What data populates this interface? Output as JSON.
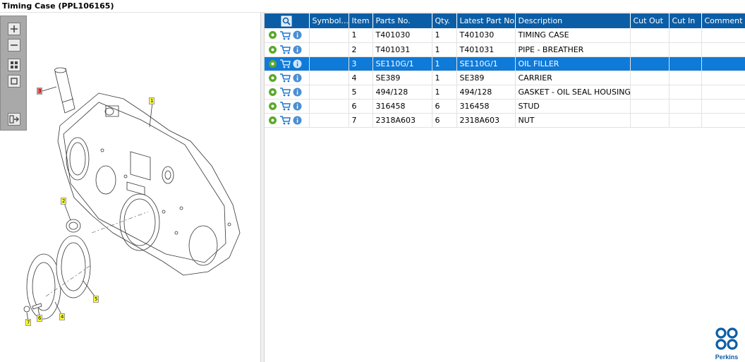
{
  "window": {
    "title": "Timing Case (PPL106165)"
  },
  "table": {
    "headers": [
      "",
      "Symbol...",
      "Item",
      "Parts No.",
      "Qty.",
      "Latest Part No.",
      "Description",
      "Cut Out",
      "Cut In",
      "Comment"
    ],
    "rows": [
      {
        "symbol": "",
        "item": "1",
        "part_no": "T401030",
        "qty": "1",
        "latest_part_no": "T401030",
        "description": "TIMING CASE",
        "cut_out": "",
        "cut_in": "",
        "comment": ""
      },
      {
        "symbol": "",
        "item": "2",
        "part_no": "T401031",
        "qty": "1",
        "latest_part_no": "T401031",
        "description": "PIPE - BREATHER",
        "cut_out": "",
        "cut_in": "",
        "comment": ""
      },
      {
        "symbol": "",
        "item": "3",
        "part_no": "SE110G/1",
        "qty": "1",
        "latest_part_no": "SE110G/1",
        "description": "OIL FILLER",
        "cut_out": "",
        "cut_in": "",
        "comment": ""
      },
      {
        "symbol": "",
        "item": "4",
        "part_no": "SE389",
        "qty": "1",
        "latest_part_no": "SE389",
        "description": "CARRIER",
        "cut_out": "",
        "cut_in": "",
        "comment": ""
      },
      {
        "symbol": "",
        "item": "5",
        "part_no": "494/128",
        "qty": "1",
        "latest_part_no": "494/128",
        "description": "GASKET - OIL SEAL HOUSING",
        "cut_out": "",
        "cut_in": "",
        "comment": ""
      },
      {
        "symbol": "",
        "item": "6",
        "part_no": "316458",
        "qty": "6",
        "latest_part_no": "316458",
        "description": "STUD",
        "cut_out": "",
        "cut_in": "",
        "comment": ""
      },
      {
        "symbol": "",
        "item": "7",
        "part_no": "2318A603",
        "qty": "6",
        "latest_part_no": "2318A603",
        "description": "NUT",
        "cut_out": "",
        "cut_in": "",
        "comment": ""
      }
    ],
    "selected_item": "3"
  },
  "drawing": {
    "callouts": [
      "1",
      "2",
      "3",
      "4",
      "5",
      "6",
      "7"
    ],
    "highlighted_callout": "3"
  },
  "logo": {
    "text": "Perkins"
  },
  "colors": {
    "header": "#0b5ea6",
    "selected_row": "#0f7ad8",
    "callout": "#ffff33",
    "callout_selected": "#ff6b6b",
    "logo": "#0b5ea6"
  }
}
